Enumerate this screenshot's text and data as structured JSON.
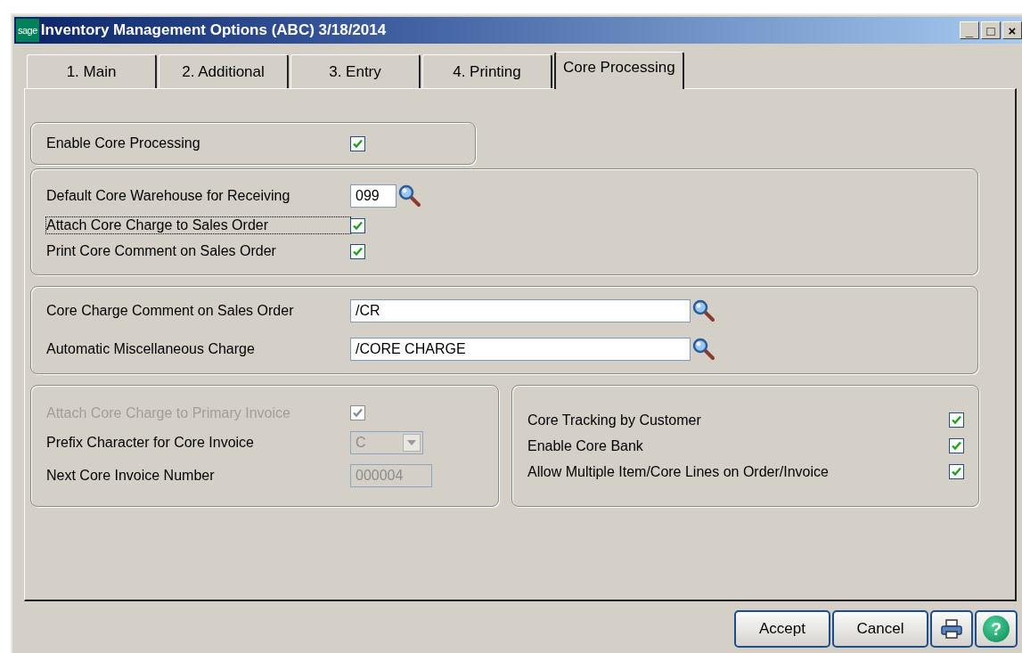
{
  "window": {
    "logo": "sage",
    "title": "Inventory Management Options (ABC) 3/18/2014",
    "controls": [
      "_",
      "□",
      "×"
    ]
  },
  "tabs": [
    {
      "label": "1. Main",
      "selected": false
    },
    {
      "label": "2. Additional",
      "selected": false
    },
    {
      "label": "3. Entry",
      "selected": false
    },
    {
      "label": "4. Printing",
      "selected": false
    },
    {
      "label": "Core Processing",
      "selected": true
    }
  ],
  "groups": [
    {
      "rows": [
        {
          "kind": "checkbox",
          "label": "Enable Core Processing",
          "checked": true,
          "disabled": false,
          "focused": false
        }
      ]
    },
    {
      "rows": [
        {
          "kind": "code-lookup",
          "label": "Default Core Warehouse for Receiving",
          "value": "099",
          "disabled": false,
          "focused": false
        },
        {
          "kind": "checkbox",
          "label": "Attach Core Charge to Sales Order",
          "checked": true,
          "disabled": false,
          "focused": true
        },
        {
          "kind": "checkbox",
          "label": "Print Core Comment on Sales Order",
          "checked": true,
          "disabled": false,
          "focused": false
        }
      ]
    },
    {
      "rows": [
        {
          "kind": "text-lookup",
          "label": "Core Charge Comment on Sales Order",
          "value": "/CR",
          "disabled": false,
          "focused": false
        },
        {
          "kind": "text-lookup",
          "label": "Automatic Miscellaneous Charge",
          "value": "/CORE CHARGE",
          "disabled": false,
          "focused": false
        }
      ]
    }
  ],
  "side_groups": [
    {
      "rows": [
        {
          "kind": "checkbox",
          "label": "Attach Core Charge to Primary Invoice",
          "checked": true,
          "disabled": true,
          "focused": false
        },
        {
          "kind": "select",
          "label": "Prefix Character for Core Invoice",
          "value": "C",
          "disabled": true,
          "focused": false
        },
        {
          "kind": "number",
          "label": "Next Core Invoice Number",
          "value": "000004",
          "disabled": true,
          "focused": false
        }
      ]
    },
    {
      "rows": [
        {
          "kind": "checkbox",
          "label": "Core Tracking by Customer",
          "checked": true,
          "disabled": false,
          "focused": false
        },
        {
          "kind": "checkbox",
          "label": "Enable Core Bank",
          "checked": true,
          "disabled": false,
          "focused": false
        },
        {
          "kind": "checkbox",
          "label": "Allow Multiple Item/Core Lines on Order/Invoice",
          "checked": true,
          "disabled": false,
          "focused": false
        }
      ]
    }
  ],
  "buttons": [
    {
      "kind": "text",
      "label": "Accept"
    },
    {
      "kind": "text",
      "label": "Cancel"
    },
    {
      "kind": "print"
    },
    {
      "kind": "help",
      "label": "?"
    }
  ]
}
